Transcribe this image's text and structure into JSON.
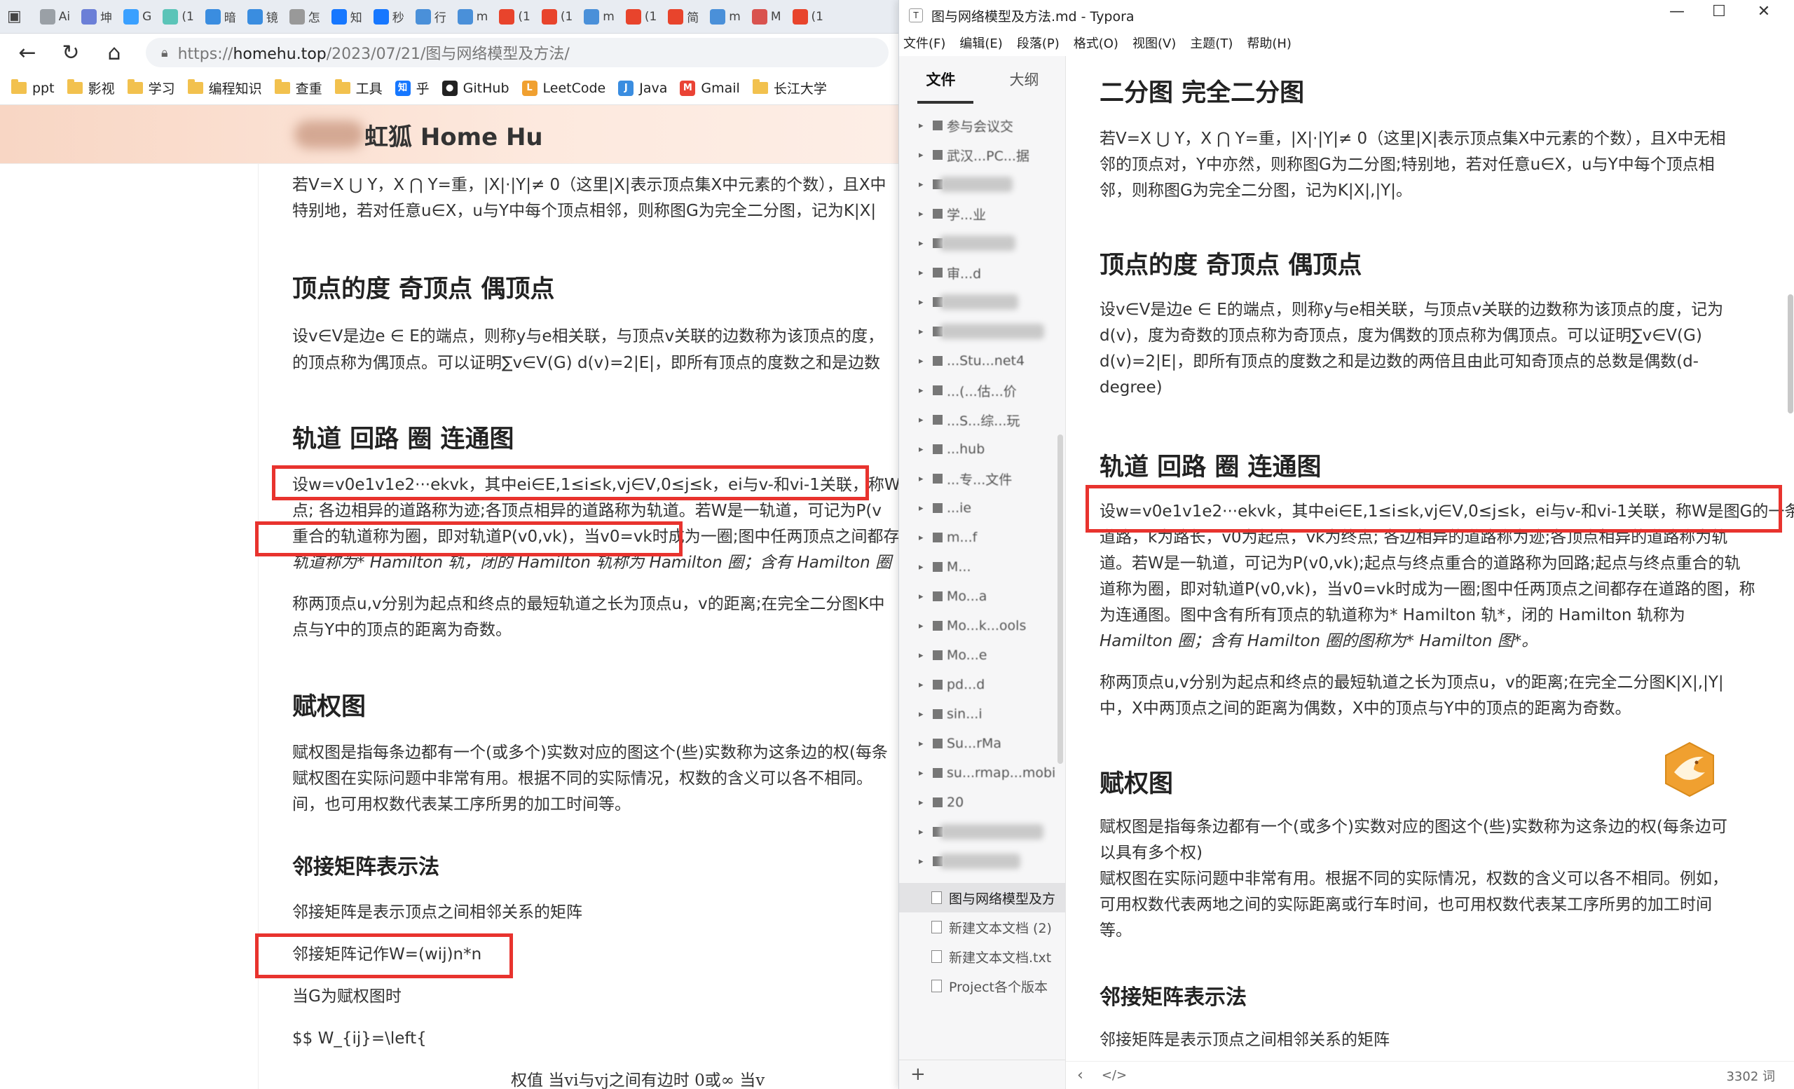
{
  "browser": {
    "tabs": [
      "Ai",
      "坤",
      "G",
      "(1",
      "暗",
      "镜",
      "怎",
      "知",
      "秒",
      "行",
      "m",
      "(1",
      "(1",
      "m",
      "(1",
      "简",
      "m",
      "M",
      "(1"
    ],
    "tab_colors": [
      "#9aa0a6",
      "#6b7fd7",
      "#3aa0ff",
      "#5bc4b8",
      "#3a8de0",
      "#3a8de0",
      "#999",
      "#1677ff",
      "#1677ff",
      "#4a90d9",
      "#4a90d9",
      "#e8442c",
      "#e8442c",
      "#4a90d9",
      "#e8442c",
      "#e8442c",
      "#4a90d9",
      "#d9534f",
      "#e8442c"
    ],
    "url_prefix": "https://",
    "url_host": "homehu.top",
    "url_path": "/2023/07/21/图与网络模型及方法/",
    "bookmarks": [
      {
        "label": "ppt",
        "icon": "folder-icon"
      },
      {
        "label": "影视",
        "icon": "folder-icon"
      },
      {
        "label": "学习",
        "icon": "folder-icon"
      },
      {
        "label": "编程知识",
        "icon": "folder-icon"
      },
      {
        "label": "查重",
        "icon": "folder-icon"
      },
      {
        "label": "工具",
        "icon": "folder-icon"
      },
      {
        "label": "乎",
        "icon": "zhihu-icon"
      },
      {
        "label": "GitHub",
        "icon": "github-icon"
      },
      {
        "label": "LeetCode",
        "icon": "leetcode-icon"
      },
      {
        "label": "Java",
        "icon": "java-icon"
      },
      {
        "label": "Gmail",
        "icon": "gmail-icon"
      },
      {
        "label": "长江大学",
        "icon": "folder-icon"
      }
    ],
    "site_title": "虹狐 Home Hu"
  },
  "article": {
    "p1_line1": "若V=X ⋃ Y，X ⋂ Y=重，|X|·|Y|≠ 0（这里|X|表示顶点集X中元素的个数），且X中",
    "p1_line2": "特别地，若对任意u∈X，u与Y中每个顶点相邻，则称图G为完全二分图，记为K|X|",
    "h_degree": "顶点的度 奇顶点 偶顶点",
    "p2_line1": "设v∈V是边e ∈ E的端点，则称y与e相关联，与顶点v关联的边数称为该顶点的度，",
    "p2_line2": "的顶点称为偶顶点。可以证明∑v∈V(G) d(v)=2|E|，即所有顶点的度数之和是边数",
    "h_path": "轨道 回路 圈 连通图",
    "p3_line1": "设w=v0e1v1e2···ekvk，其中ei∈E,1≤i≤k,vj∈V,0≤j≤k，ei与v-和vi-1关联，称W",
    "p3_line2": "点; 各边相异的道路称为迹;各顶点相异的道路称为轨道。若W是一轨道，可记为P(v",
    "p3_line3": "重合的轨道称为圈，即对轨道P(v0,vk)，当v0=vk时成为一圈;图中任两顶点之间都存",
    "p3_line4": "轨道称为* Hamilton 轨，闭的 Hamilton 轨称为 Hamilton 圈；含有 Hamilton 圈",
    "p4_line1": "称两顶点u,v分别为起点和终点的最短轨道之长为顶点u，v的距离;在完全二分图K中",
    "p4_line2": "点与Y中的顶点的距离为奇数。",
    "h_weighted": "赋权图",
    "p5_line1": "赋权图是指每条边都有一个(或多个)实数对应的图这个(些)实数称为这条边的权(每条",
    "p5_line2": "赋权图在实际问题中非常有用。根据不同的实际情况，权数的含义可以各不相同。",
    "p5_line3": "间，也可用权数代表某工序所男的加工时间等。",
    "h_matrix": "邻接矩阵表示法",
    "p6": "邻接矩阵是表示顶点之间相邻关系的矩阵",
    "p7": "邻接矩阵记作W=(wij)n*n",
    "p8": "当G为赋权图时",
    "p9": "$$ W_{ij}=\\left{",
    "formula": "权值      当vi与vj之间有边时 0或∞        当v"
  },
  "typora": {
    "window_title": "图与网络模型及方法.md - Typora",
    "menu": [
      "文件(F)",
      "编辑(E)",
      "段落(P)",
      "格式(O)",
      "视图(V)",
      "主题(T)",
      "帮助(H)"
    ],
    "sidebar_tabs": [
      "文件",
      "大纲"
    ],
    "tree": [
      "参与会议交",
      "武汉...PC...据",
      "",
      "学...业",
      "",
      "审...d",
      "",
      "",
      "...Stu...net4",
      "...(...估...价",
      "...S...综...玩",
      "...hub",
      "...专...文件",
      "...ie",
      "m...f",
      "M...",
      "Mo...a",
      "Mo...k...ools",
      "Mo...e",
      "pd...d",
      "sin...i",
      "Su...rMa",
      "su...rmap...mobi",
      "20",
      "",
      ""
    ],
    "docs": [
      "图与网络模型及方",
      "新建文本文档 (2)",
      "新建文本文档.txt",
      "Project各个版本"
    ],
    "h_bipartite": "二分图 完全二分图",
    "e1_line1": "若V=X ⋃ Y，X ⋂ Y=重，|X|·|Y|≠ 0（这里|X|表示顶点集X中元素的个数），且X中无相",
    "e1_line2": "邻的顶点对，Y中亦然，则称图G为二分图;特别地，若对任意u∈X，u与Y中每个顶点相",
    "e1_line3": "邻，则称图G为完全二分图，记为K|X|,|Y|。",
    "h_degree": "顶点的度 奇顶点 偶顶点",
    "e2_line1": "设v∈V是边e ∈ E的端点，则称y与e相关联，与顶点v关联的边数称为该顶点的度，记为",
    "e2_line2": "d(v)，度为奇数的顶点称为奇顶点，度为偶数的顶点称为偶顶点。可以证明∑v∈V(G)",
    "e2_line3": "d(v)=2|E|，即所有顶点的度数之和是边数的两倍且由此可知奇顶点的总数是偶数(d-",
    "e2_line4": "degree)",
    "h_path": "轨道 回路 圈 连通图",
    "e3_line1": "设w=v0e1v1e2···ekvk，其中ei∈E,1≤i≤k,vj∈V,0≤j≤k，ei与v-和vi-1关联，称W是图G的一条",
    "e3_line2": "道路，k为路长，v0为起点，vk为终点; 各边相异的道路称为迹;各顶点相异的道路称为轨",
    "e3_line3": "道。若W是一轨道，可记为P(v0,vk);起点与终点重合的道路称为回路;起点与终点重合的轨",
    "e3_line4": "道称为圈，即对轨道P(v0,vk)，当v0=vk时成为一圈;图中任两顶点之间都存在道路的图，称",
    "e3_line5": "为连通图。图中含有所有顶点的轨道称为* Hamilton 轨*，闭的 Hamilton 轨称为",
    "e3_line6": "Hamilton 圈；含有 Hamilton 圈的图称为* Hamilton 图*。",
    "e4_line1": "称两顶点u,v分别为起点和终点的最短轨道之长为顶点u，v的距离;在完全二分图K|X|,|Y|",
    "e4_line2": "中，X中两顶点之间的距离为偶数，X中的顶点与Y中的顶点的距离为奇数。",
    "h_weighted": "赋权图",
    "e5_line1": "赋权图是指每条边都有一个(或多个)实数对应的图这个(些)实数称为这条边的权(每条边可",
    "e5_line2": "以具有多个权)",
    "e5_line3": "赋权图在实际问题中非常有用。根据不同的实际情况，权数的含义可以各不相同。例如，",
    "e5_line4": "可用权数代表两地之间的实际距离或行车时间，也可用权数代表某工序所男的加工时间",
    "e5_line5": "等。",
    "h_matrix": "邻接矩阵表示法",
    "e6": "邻接矩阵是表示顶点之间相邻关系的矩阵",
    "word_count": "3302 词",
    "status_left": "‹",
    "status_code": "</>"
  },
  "colors": {
    "highlight_box": "#e8332e",
    "accent_orange": "#f0a030"
  }
}
